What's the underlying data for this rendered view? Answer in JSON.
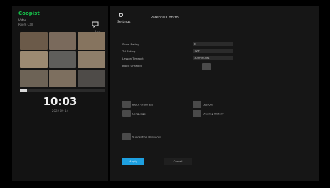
{
  "left": {
    "brand": "Coopist",
    "meta_line1": "Video",
    "meta_line2": "Room Call",
    "status_small": "Sync",
    "clock": "10:03",
    "date": "2022-09-14",
    "progress": 0.08
  },
  "settings": {
    "label": "Settings",
    "title": "Parental Control",
    "rows": [
      {
        "label": "Show Rating",
        "value": "E"
      },
      {
        "label": "TV Rating",
        "value": "TV-Y"
      },
      {
        "label": "Lesson Timeout",
        "value": "30 minutes"
      },
      {
        "label": "Block Unrated",
        "toggle": true
      }
    ],
    "checkboxes": [
      {
        "label": "Block Channels"
      },
      {
        "label": "Lessons"
      },
      {
        "label": "Language"
      },
      {
        "label": "Viewing History"
      },
      {
        "label": "Suggestion Messages"
      }
    ],
    "apply_label": "Apply",
    "cancel_label": "Cancel"
  },
  "colors": {
    "brand": "#16c24a",
    "accent": "#1ea0e0"
  }
}
